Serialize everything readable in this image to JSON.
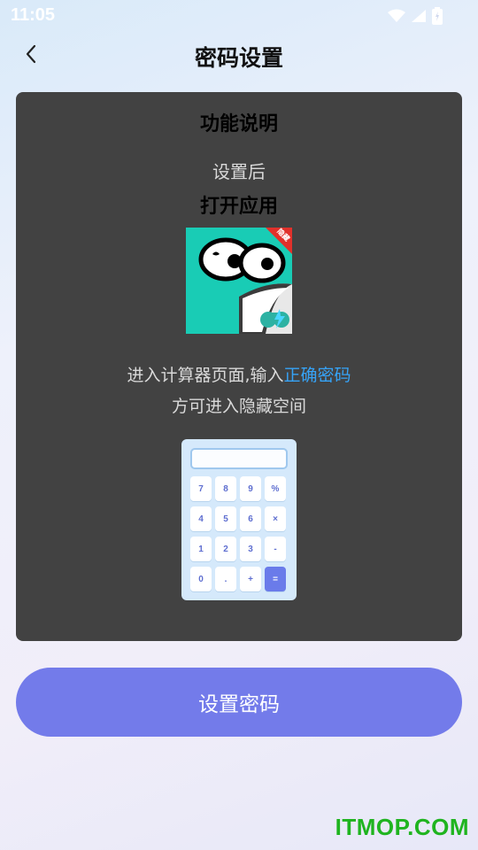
{
  "status_bar": {
    "time": "11:05",
    "icons": [
      "wifi-icon",
      "signal-icon",
      "battery-icon"
    ]
  },
  "header": {
    "title": "密码设置",
    "back_icon": "chevron-left-icon"
  },
  "card": {
    "title": "功能说明",
    "subtitle": "设置后",
    "subtitle2": "打开应用",
    "app_icon": {
      "badge": "隐藏",
      "name": "app-icon"
    },
    "instruction_line1_prefix": "进入计算器页面,输入",
    "instruction_line1_highlight": "正确密码",
    "instruction_line2": "方可进入隐藏空间",
    "calculator_keys": [
      "7",
      "8",
      "9",
      "%",
      "4",
      "5",
      "6",
      "×",
      "1",
      "2",
      "3",
      "-",
      "0",
      ".",
      "+",
      "="
    ]
  },
  "primary_button": {
    "label": "设置密码"
  },
  "watermark": "ITMOP.COM",
  "colors": {
    "accent": "#737bea",
    "highlight": "#36a3f7",
    "card_bg": "#424242",
    "watermark": "#1fb41f"
  }
}
